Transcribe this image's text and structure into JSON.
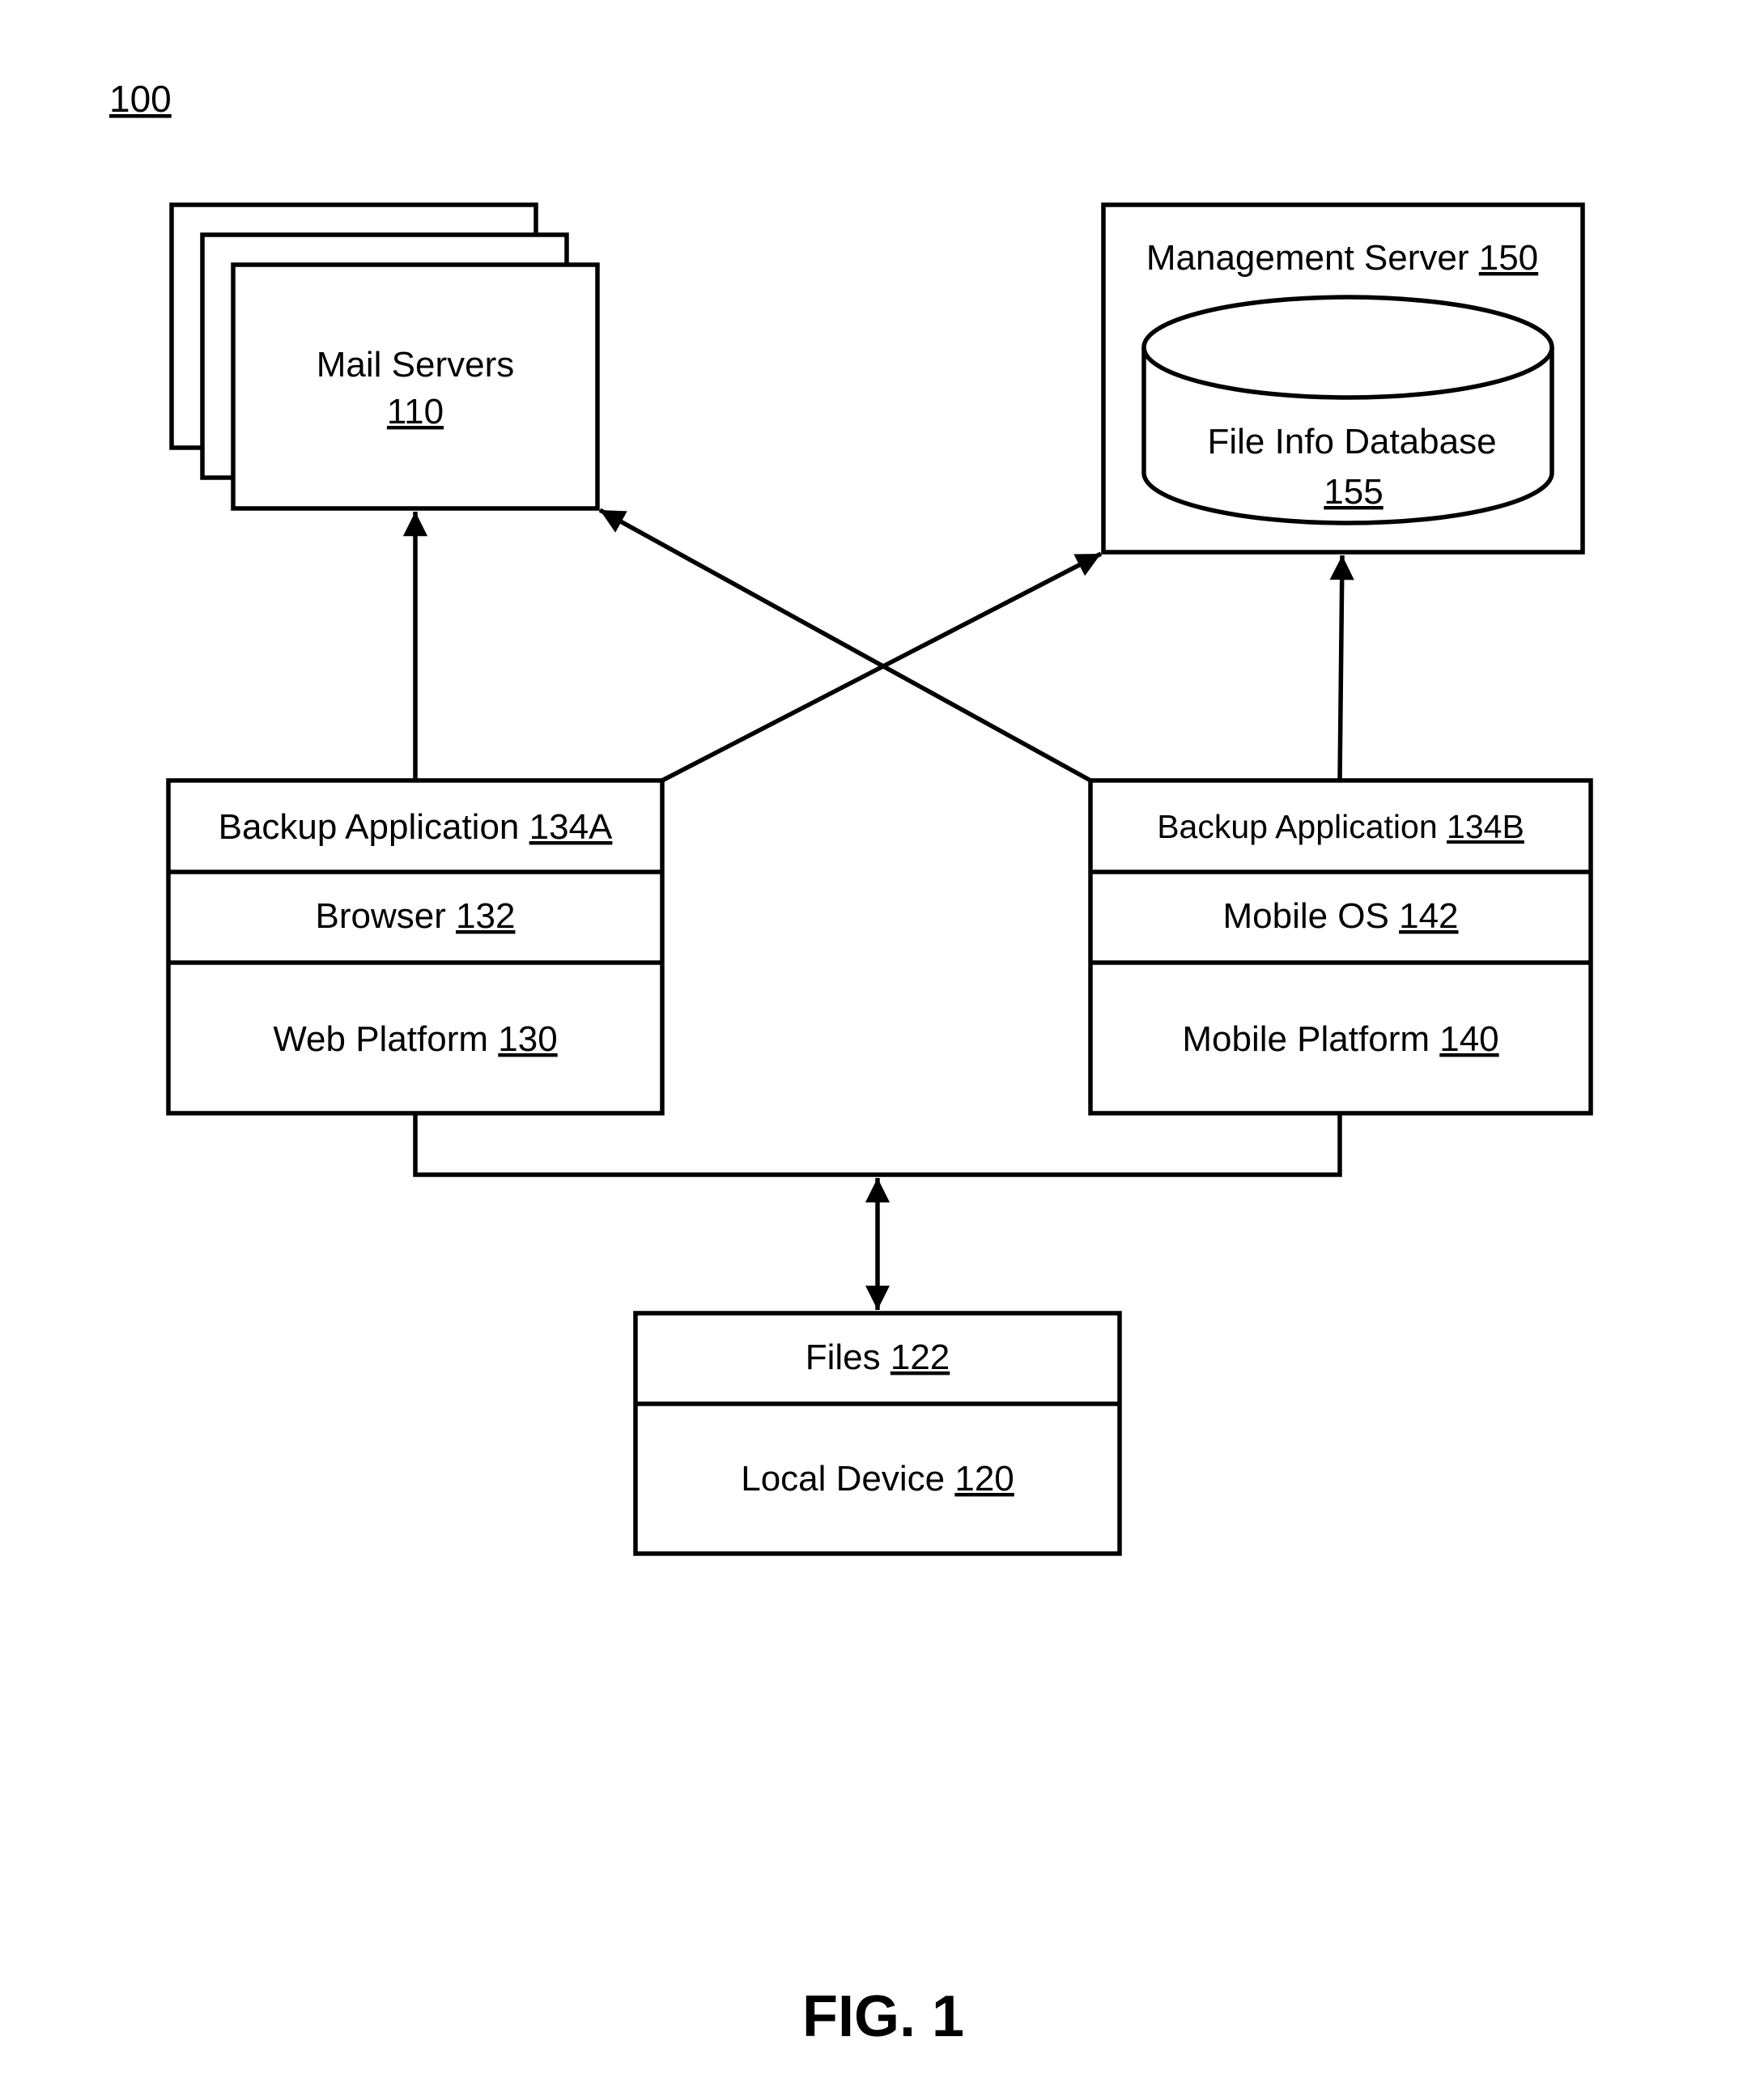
{
  "figure": {
    "reference_number": "100",
    "caption": "FIG. 1"
  },
  "mail_servers": {
    "label": "Mail Servers",
    "ref": "110"
  },
  "management_server": {
    "label": "Management Server ",
    "ref": "150",
    "database": {
      "label": "File Info Database",
      "ref": "155"
    }
  },
  "web_platform": {
    "layers": [
      {
        "label": "Backup Application ",
        "ref": "134A"
      },
      {
        "label": "Browser ",
        "ref": "132"
      },
      {
        "label": "Web Platform ",
        "ref": "130"
      }
    ]
  },
  "mobile_platform": {
    "layers": [
      {
        "label": "Backup Application ",
        "ref": "134B"
      },
      {
        "label": "Mobile OS ",
        "ref": "142"
      },
      {
        "label": "Mobile Platform ",
        "ref": "140"
      }
    ]
  },
  "local_device": {
    "layers": [
      {
        "label": "Files ",
        "ref": "122"
      },
      {
        "label": "Local Device ",
        "ref": "120"
      }
    ]
  },
  "connections": [
    {
      "from": "Web Platform 130",
      "to": "Mail Servers 110",
      "direction": "one-way"
    },
    {
      "from": "Web Platform 130",
      "to": "Management Server 150",
      "direction": "one-way"
    },
    {
      "from": "Mobile Platform 140",
      "to": "Mail Servers 110",
      "direction": "one-way"
    },
    {
      "from": "Mobile Platform 140",
      "to": "Management Server 150",
      "direction": "one-way"
    },
    {
      "from": "Web Platform 130 / Mobile Platform 140",
      "to": "Local Device 120",
      "direction": "two-way"
    }
  ]
}
